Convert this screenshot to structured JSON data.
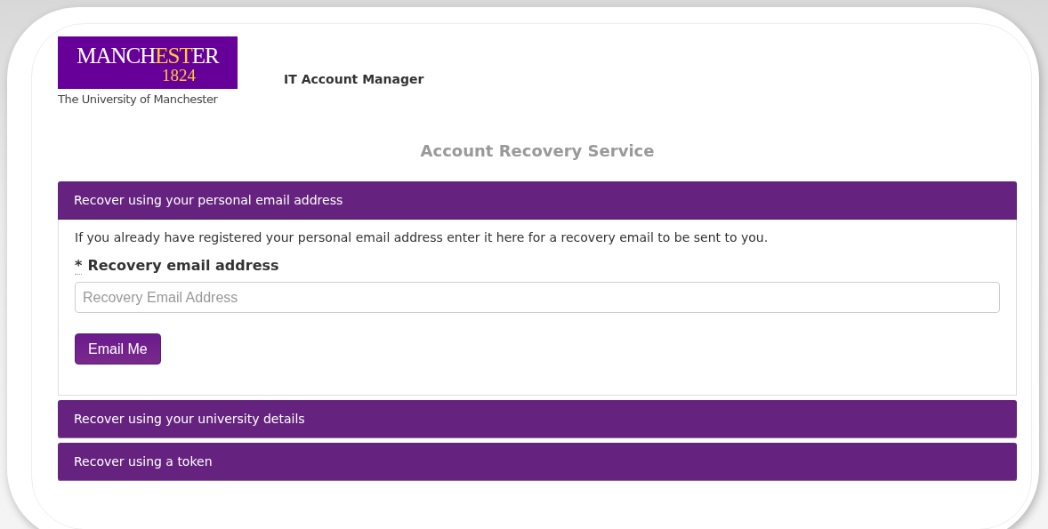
{
  "logo": {
    "wordmark": [
      {
        "text": "MANCH",
        "highlight": false
      },
      {
        "text": "EST",
        "highlight": true
      },
      {
        "text": "ER",
        "highlight": false
      }
    ],
    "year": "1824",
    "caption": "The University of Manchester"
  },
  "app_title": "IT Account Manager",
  "page_title": "Account Recovery Service",
  "sections": [
    {
      "title": "Recover using your personal email address",
      "expanded": true,
      "intro": "If you already have registered your personal email address enter it here for a recovery email to be sent to you.",
      "required_mark": "*",
      "field_label": "Recovery email address",
      "placeholder": "Recovery Email Address",
      "button": "Email Me"
    },
    {
      "title": "Recover using your university details",
      "expanded": false
    },
    {
      "title": "Recover using a token",
      "expanded": false
    }
  ]
}
